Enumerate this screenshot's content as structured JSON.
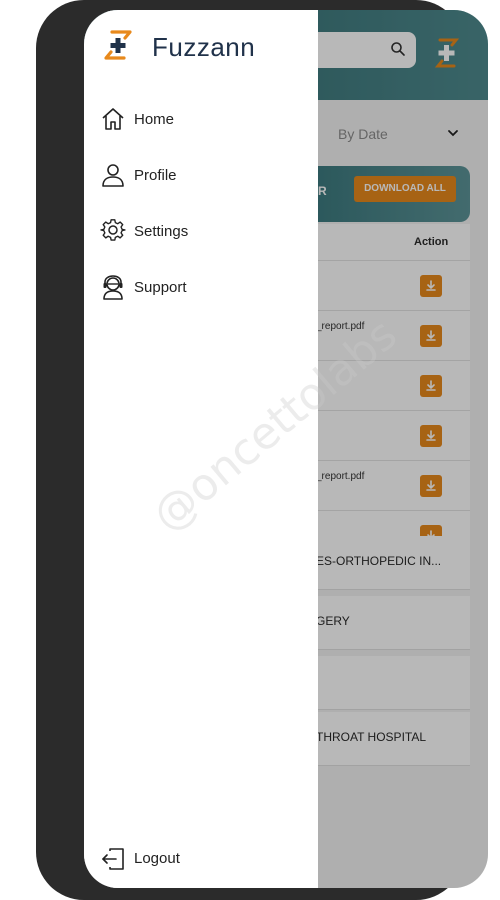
{
  "app": {
    "name": "Fuzzann"
  },
  "drawer": {
    "items": [
      {
        "label": "Home",
        "icon": "home-icon"
      },
      {
        "label": "Profile",
        "icon": "person-icon"
      },
      {
        "label": "Settings",
        "icon": "gear-icon"
      },
      {
        "label": "Support",
        "icon": "support-agent-icon"
      }
    ],
    "logout": {
      "label": "Logout",
      "icon": "logout-icon"
    }
  },
  "background": {
    "sort": {
      "label": "By Date"
    },
    "banner": {
      "partial_text": "R",
      "download_all_label": "DOWNLOAD ALL"
    },
    "table": {
      "action_header": "Action",
      "rows": [
        {
          "file": ""
        },
        {
          "file": "_report.pdf"
        },
        {
          "file": ""
        },
        {
          "file": ""
        },
        {
          "file": "_report.pdf"
        }
      ]
    },
    "list": [
      {
        "text": "ES-ORTHOPEDIC IN..."
      },
      {
        "text": "GERY"
      },
      {
        "text": ""
      },
      {
        "text": "THROAT HOSPITAL"
      }
    ]
  },
  "watermark": "@oncettolabs",
  "colors": {
    "accent": "#e8891c",
    "brand_text": "#20324a",
    "header_teal": "#2f6a6e"
  }
}
